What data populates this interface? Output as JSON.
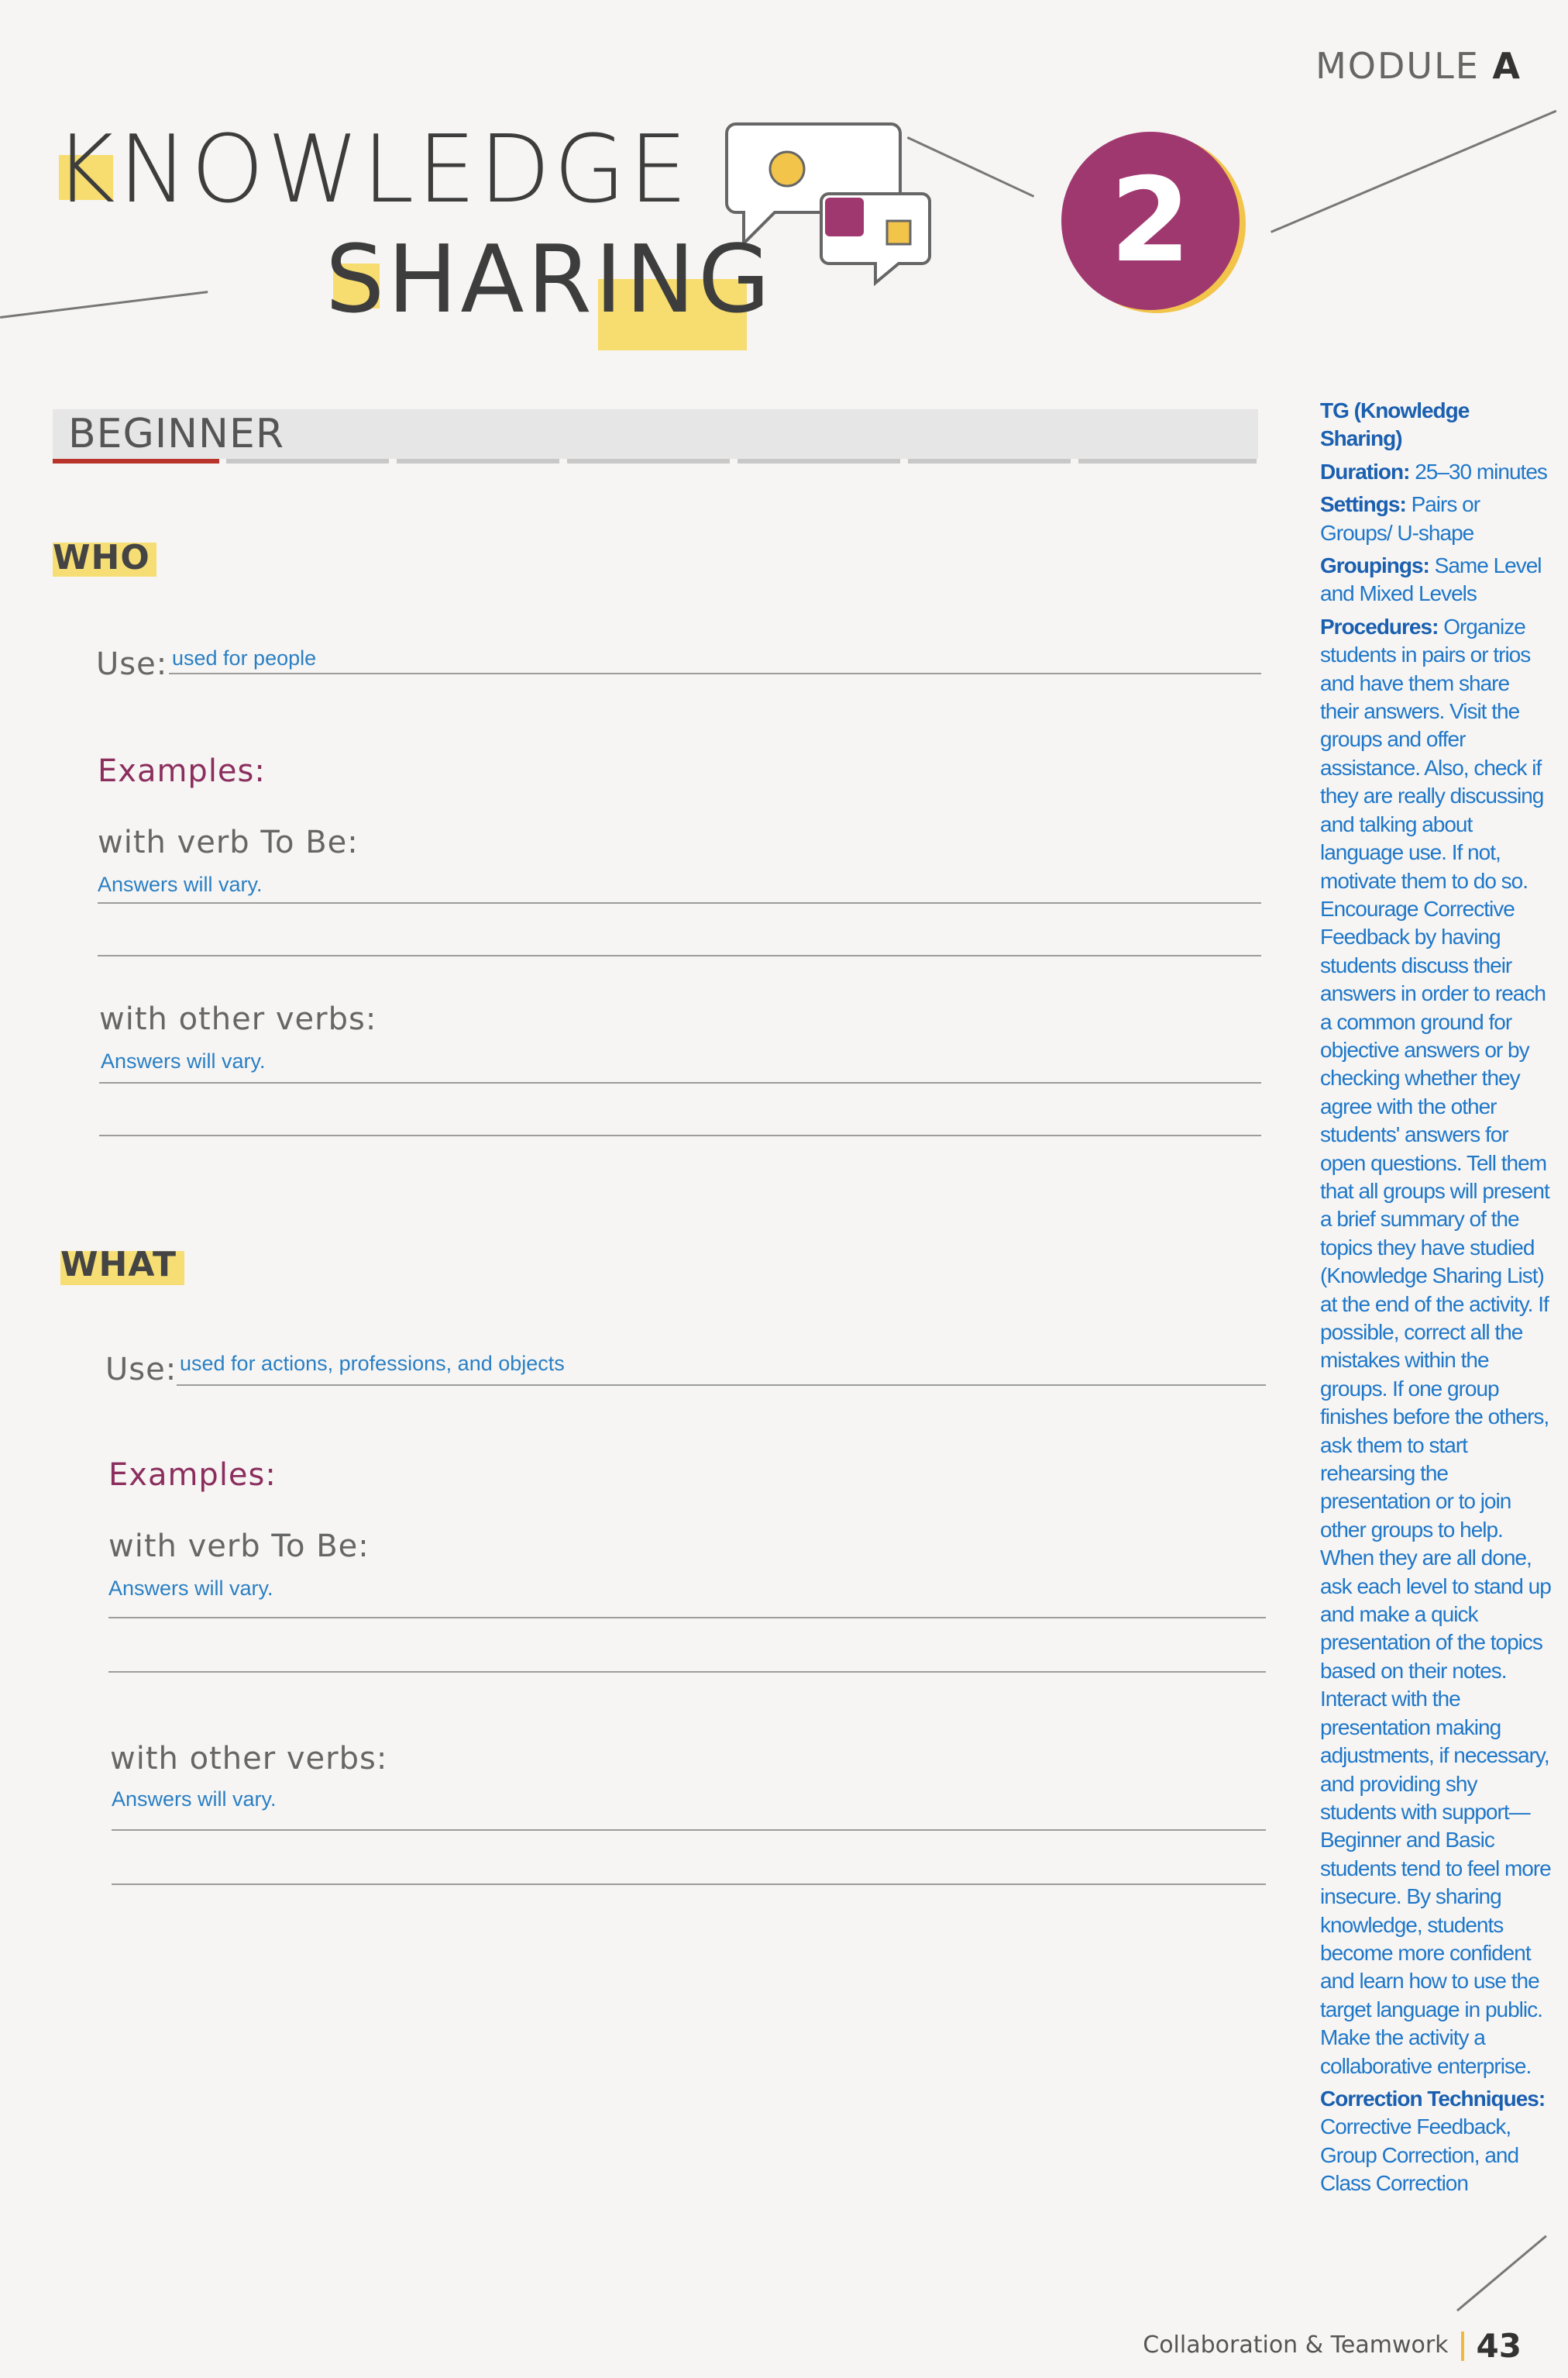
{
  "module": {
    "prefix": "MODULE ",
    "letter": "A"
  },
  "title": {
    "line1": "KNOWLEDGE",
    "line2": "SHARING"
  },
  "badge_number": "2",
  "level": "BEGINNER",
  "who": {
    "heading": "WHO",
    "use_label": "Use:",
    "use_answer": "used for people",
    "examples_label": "Examples:",
    "to_be_label": "with verb To Be:",
    "to_be_answer": "Answers will vary.",
    "other_label": "with other verbs:",
    "other_answer": "Answers will vary."
  },
  "what": {
    "heading": "WHAT",
    "use_label": "Use:",
    "use_answer": "used for actions, professions, and objects",
    "examples_label": "Examples:",
    "to_be_label": "with verb To Be:",
    "to_be_answer": "Answers will vary.",
    "other_label": "with other verbs:",
    "other_answer": "Answers will vary."
  },
  "sidebar": {
    "tg": "TG (Knowledge Sharing)",
    "duration_label": "Duration:",
    "duration": "25–30 minutes",
    "settings_label": "Settings:",
    "settings": "Pairs or Groups/ U-shape",
    "groupings_label": "Groupings:",
    "groupings": "Same Level and Mixed Levels",
    "procedures_label": "Procedures:",
    "procedures": "Organize students in pairs or trios and have them share their answers. Visit the groups and offer assistance. Also, check if they are really discussing and talking about language use. If not, motivate them to do so. Encourage Corrective Feedback by having students discuss their answers in order to reach a common ground for objective answers or by checking whether they agree with the other students' answers for open questions. Tell them that all groups will present a brief summary of the topics they have studied (Knowledge Sharing List) at the end of the activity. If possible, correct all the mistakes within the groups. If one group finishes before the others, ask them to start rehearsing the presentation or to join other groups to help. When they are all done, ask each level to stand up and make a quick presentation of the topics based on their notes. Interact with the presentation making adjustments, if necessary, and providing shy students with support—Beginner and Basic students tend to feel more insecure. By sharing knowledge, students become more confident and learn how to use the target language in public. Make the activity a collaborative enterprise.",
    "correction_label": "Correction Techniques:",
    "correction": "Corrective Feedback, Group Correction, and Class Correction"
  },
  "footer": {
    "text": "Collaboration & Teamwork",
    "page": "43"
  }
}
